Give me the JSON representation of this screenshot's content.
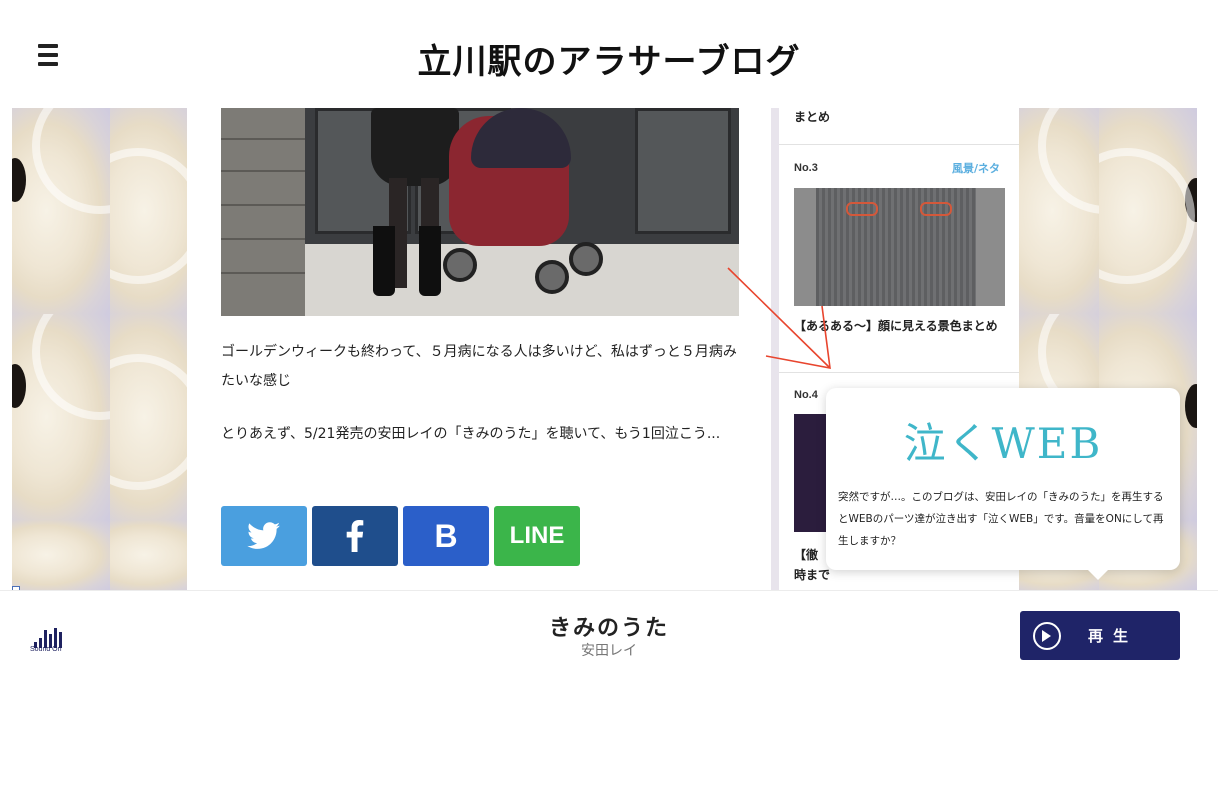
{
  "header": {
    "title": "立川駅のアラサーブログ",
    "menu_icon": "hamburger-icon"
  },
  "article": {
    "paragraphs": [
      "ゴールデンウィークも終わって、５月病になる人は多いけど、私はずっと５月病みたいな感じ",
      "とりあえず、5/21発売の安田レイの「きみのうた」を聴いて、もう1回泣こう..."
    ],
    "share_buttons": [
      {
        "name": "twitter",
        "icon": "twitter-bird-icon",
        "color": "#4a9fdf"
      },
      {
        "name": "facebook",
        "icon": "facebook-f-icon",
        "color": "#1f4e8c"
      },
      {
        "name": "hatena",
        "label": "B",
        "color": "#2b5fc9"
      },
      {
        "name": "line",
        "label": "LINE",
        "color": "#3bb54a"
      }
    ]
  },
  "sidebar": {
    "top_fragment": "まとめ",
    "items": [
      {
        "no": "No.3",
        "category": "風景/ネタ",
        "title": "【あるある〜】顔に見える景色まとめ"
      },
      {
        "no": "No.4",
        "title_fragment_1": "【徹",
        "title_fragment_2": "時まで"
      }
    ]
  },
  "popup": {
    "logo": "泣くWEB",
    "body": "突然ですが…。このブログは、安田レイの「きみのうた」を再生するとWEBのパーツ達が泣き出す「泣くWEB」です。音量をONにして再生しますか？"
  },
  "player": {
    "sound_label": "Sound On",
    "song_title": "きみのうた",
    "artist": "安田レイ",
    "play_label": "再生",
    "accent_color": "#1f2468"
  }
}
